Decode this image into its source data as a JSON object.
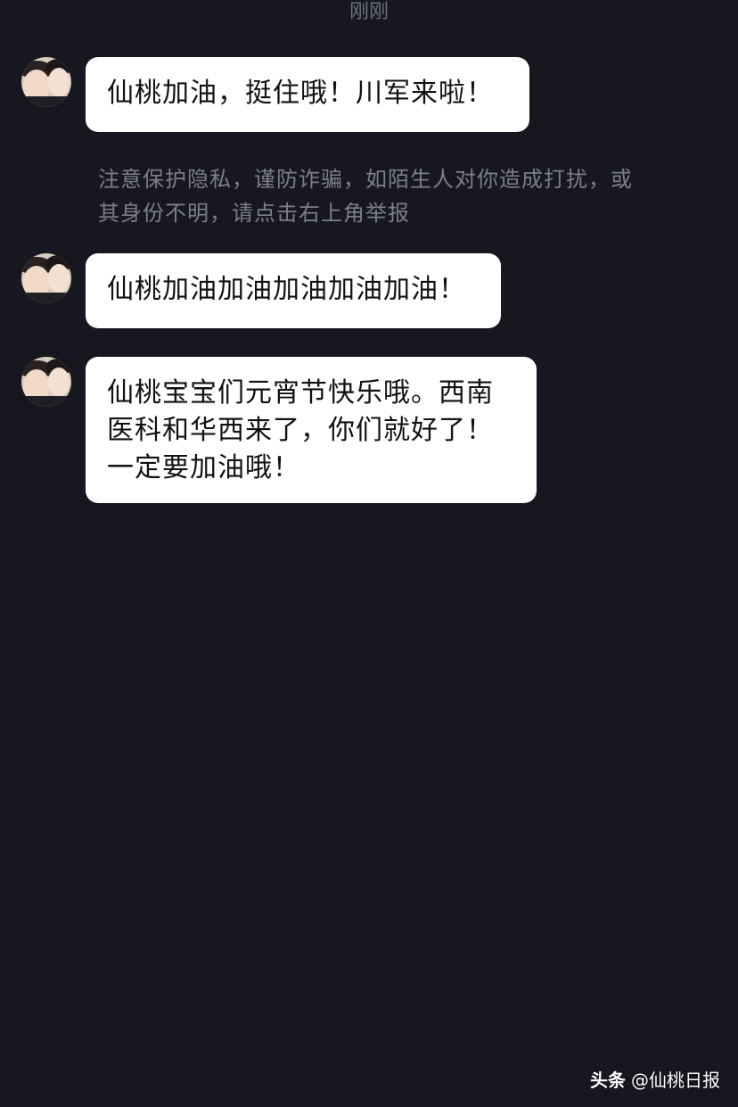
{
  "chat": {
    "timestamp": "刚刚",
    "messages": [
      {
        "text": "仙桃加油，挺住哦！川军来啦！"
      },
      {
        "text": "仙桃加油加油加油加油加油！"
      },
      {
        "text": "仙桃宝宝们元宵节快乐哦。西南\n医科和华西来了，你们就好了！\n一定要加油哦！"
      }
    ],
    "privacy_notice": "注意保护隐私，谨防诈骗，如陌生人对你造成打扰，或其身份不明，请点击右上角举报"
  },
  "watermark": {
    "brand": "头条",
    "account": "@仙桃日报"
  },
  "colors": {
    "background": "#16171f",
    "bubble": "#ffffff",
    "muted_text": "#7d7f88"
  }
}
